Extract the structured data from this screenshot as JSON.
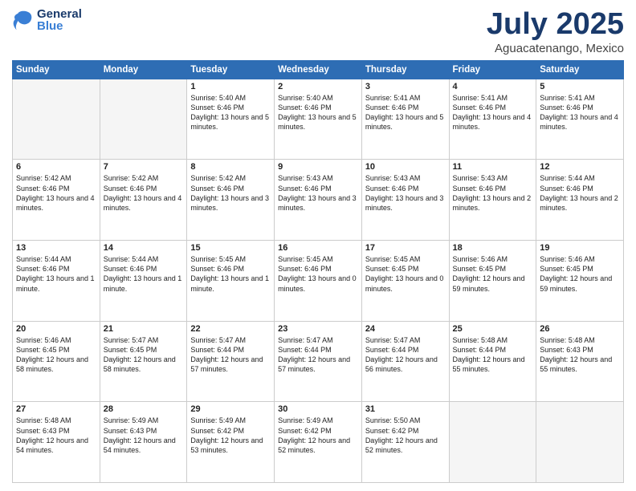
{
  "header": {
    "logo_general": "General",
    "logo_blue": "Blue",
    "month_title": "July 2025",
    "location": "Aguacatenango, Mexico"
  },
  "days_of_week": [
    "Sunday",
    "Monday",
    "Tuesday",
    "Wednesday",
    "Thursday",
    "Friday",
    "Saturday"
  ],
  "weeks": [
    [
      {
        "day": "",
        "content": ""
      },
      {
        "day": "",
        "content": ""
      },
      {
        "day": "1",
        "content": "Sunrise: 5:40 AM\nSunset: 6:46 PM\nDaylight: 13 hours and 5 minutes."
      },
      {
        "day": "2",
        "content": "Sunrise: 5:40 AM\nSunset: 6:46 PM\nDaylight: 13 hours and 5 minutes."
      },
      {
        "day": "3",
        "content": "Sunrise: 5:41 AM\nSunset: 6:46 PM\nDaylight: 13 hours and 5 minutes."
      },
      {
        "day": "4",
        "content": "Sunrise: 5:41 AM\nSunset: 6:46 PM\nDaylight: 13 hours and 4 minutes."
      },
      {
        "day": "5",
        "content": "Sunrise: 5:41 AM\nSunset: 6:46 PM\nDaylight: 13 hours and 4 minutes."
      }
    ],
    [
      {
        "day": "6",
        "content": "Sunrise: 5:42 AM\nSunset: 6:46 PM\nDaylight: 13 hours and 4 minutes."
      },
      {
        "day": "7",
        "content": "Sunrise: 5:42 AM\nSunset: 6:46 PM\nDaylight: 13 hours and 4 minutes."
      },
      {
        "day": "8",
        "content": "Sunrise: 5:42 AM\nSunset: 6:46 PM\nDaylight: 13 hours and 3 minutes."
      },
      {
        "day": "9",
        "content": "Sunrise: 5:43 AM\nSunset: 6:46 PM\nDaylight: 13 hours and 3 minutes."
      },
      {
        "day": "10",
        "content": "Sunrise: 5:43 AM\nSunset: 6:46 PM\nDaylight: 13 hours and 3 minutes."
      },
      {
        "day": "11",
        "content": "Sunrise: 5:43 AM\nSunset: 6:46 PM\nDaylight: 13 hours and 2 minutes."
      },
      {
        "day": "12",
        "content": "Sunrise: 5:44 AM\nSunset: 6:46 PM\nDaylight: 13 hours and 2 minutes."
      }
    ],
    [
      {
        "day": "13",
        "content": "Sunrise: 5:44 AM\nSunset: 6:46 PM\nDaylight: 13 hours and 1 minute."
      },
      {
        "day": "14",
        "content": "Sunrise: 5:44 AM\nSunset: 6:46 PM\nDaylight: 13 hours and 1 minute."
      },
      {
        "day": "15",
        "content": "Sunrise: 5:45 AM\nSunset: 6:46 PM\nDaylight: 13 hours and 1 minute."
      },
      {
        "day": "16",
        "content": "Sunrise: 5:45 AM\nSunset: 6:46 PM\nDaylight: 13 hours and 0 minutes."
      },
      {
        "day": "17",
        "content": "Sunrise: 5:45 AM\nSunset: 6:45 PM\nDaylight: 13 hours and 0 minutes."
      },
      {
        "day": "18",
        "content": "Sunrise: 5:46 AM\nSunset: 6:45 PM\nDaylight: 12 hours and 59 minutes."
      },
      {
        "day": "19",
        "content": "Sunrise: 5:46 AM\nSunset: 6:45 PM\nDaylight: 12 hours and 59 minutes."
      }
    ],
    [
      {
        "day": "20",
        "content": "Sunrise: 5:46 AM\nSunset: 6:45 PM\nDaylight: 12 hours and 58 minutes."
      },
      {
        "day": "21",
        "content": "Sunrise: 5:47 AM\nSunset: 6:45 PM\nDaylight: 12 hours and 58 minutes."
      },
      {
        "day": "22",
        "content": "Sunrise: 5:47 AM\nSunset: 6:44 PM\nDaylight: 12 hours and 57 minutes."
      },
      {
        "day": "23",
        "content": "Sunrise: 5:47 AM\nSunset: 6:44 PM\nDaylight: 12 hours and 57 minutes."
      },
      {
        "day": "24",
        "content": "Sunrise: 5:47 AM\nSunset: 6:44 PM\nDaylight: 12 hours and 56 minutes."
      },
      {
        "day": "25",
        "content": "Sunrise: 5:48 AM\nSunset: 6:44 PM\nDaylight: 12 hours and 55 minutes."
      },
      {
        "day": "26",
        "content": "Sunrise: 5:48 AM\nSunset: 6:43 PM\nDaylight: 12 hours and 55 minutes."
      }
    ],
    [
      {
        "day": "27",
        "content": "Sunrise: 5:48 AM\nSunset: 6:43 PM\nDaylight: 12 hours and 54 minutes."
      },
      {
        "day": "28",
        "content": "Sunrise: 5:49 AM\nSunset: 6:43 PM\nDaylight: 12 hours and 54 minutes."
      },
      {
        "day": "29",
        "content": "Sunrise: 5:49 AM\nSunset: 6:42 PM\nDaylight: 12 hours and 53 minutes."
      },
      {
        "day": "30",
        "content": "Sunrise: 5:49 AM\nSunset: 6:42 PM\nDaylight: 12 hours and 52 minutes."
      },
      {
        "day": "31",
        "content": "Sunrise: 5:50 AM\nSunset: 6:42 PM\nDaylight: 12 hours and 52 minutes."
      },
      {
        "day": "",
        "content": ""
      },
      {
        "day": "",
        "content": ""
      }
    ]
  ]
}
